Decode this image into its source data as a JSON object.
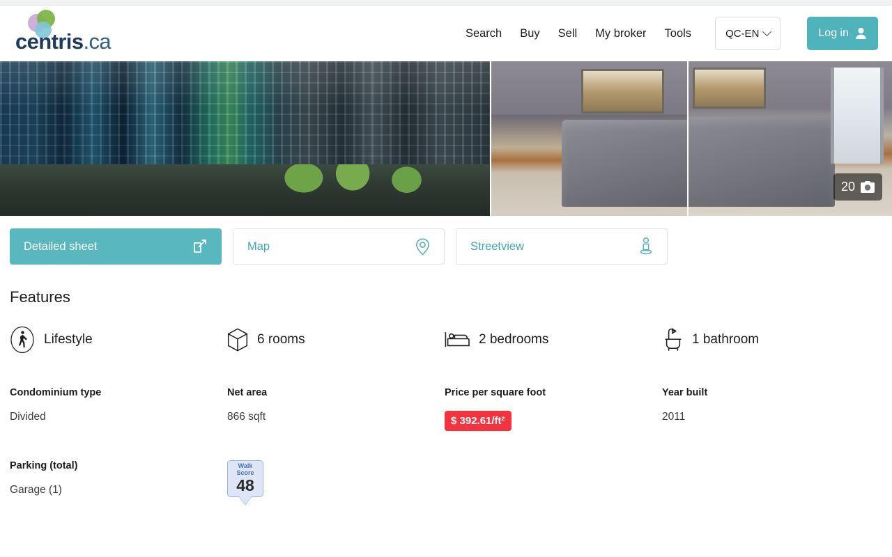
{
  "brand": {
    "name": "centris",
    "tld": ".ca",
    "logo_colors": {
      "purple": "#c9a8d4",
      "green": "#7cb342",
      "teal": "#7fc6d9"
    },
    "wordmark_color": "#1b3a5c"
  },
  "header": {
    "nav": [
      {
        "label": "Search",
        "name": "nav-search"
      },
      {
        "label": "Buy",
        "name": "nav-buy"
      },
      {
        "label": "Sell",
        "name": "nav-sell"
      },
      {
        "label": "My broker",
        "name": "nav-my-broker"
      },
      {
        "label": "Tools",
        "name": "nav-tools"
      }
    ],
    "language": {
      "label": "QC-EN",
      "icon": "chevron-down-icon"
    },
    "login": {
      "label": "Log in",
      "icon": "user-icon",
      "color": "#4fb3bc"
    }
  },
  "gallery": {
    "photo_count": "20",
    "camera_icon": "camera-icon",
    "images": [
      {
        "name": "property-photo-exterior",
        "alt": "Condo building exterior"
      },
      {
        "name": "property-photo-living-room",
        "alt": "Living room with grey sectional sofa"
      },
      {
        "name": "property-photo-living-room-window",
        "alt": "Living room with window view"
      }
    ]
  },
  "tabs": [
    {
      "label": "Detailed sheet",
      "icon": "external-link-icon",
      "active": true,
      "name": "tab-detailed-sheet"
    },
    {
      "label": "Map",
      "icon": "map-pin-icon",
      "active": false,
      "name": "tab-map"
    },
    {
      "label": "Streetview",
      "icon": "pegman-icon",
      "active": false,
      "name": "tab-streetview"
    }
  ],
  "features": {
    "title": "Features",
    "items": [
      {
        "label": "Lifestyle",
        "icon": "walking-person-circle-icon"
      },
      {
        "label": "6 rooms",
        "icon": "cube-icon"
      },
      {
        "label": "2 bedrooms",
        "icon": "bed-icon"
      },
      {
        "label": "1 bathroom",
        "icon": "bathtub-icon"
      }
    ],
    "details_row_1": [
      {
        "label": "Condominium type",
        "value": "Divided"
      },
      {
        "label": "Net area",
        "value": "866 sqft"
      },
      {
        "label": "Price per square foot",
        "value": "$ 392.61/ft²",
        "highlight": true,
        "highlight_color": "#f5333f"
      },
      {
        "label": "Year built",
        "value": "2011"
      }
    ],
    "details_row_2": [
      {
        "label": "Parking (total)",
        "value": "Garage (1)"
      }
    ],
    "walk_score": {
      "label": "Walk Score",
      "value": "48",
      "fill": "#dde5f7",
      "border": "#9db4e0",
      "label_color": "#4a6fbb"
    }
  }
}
